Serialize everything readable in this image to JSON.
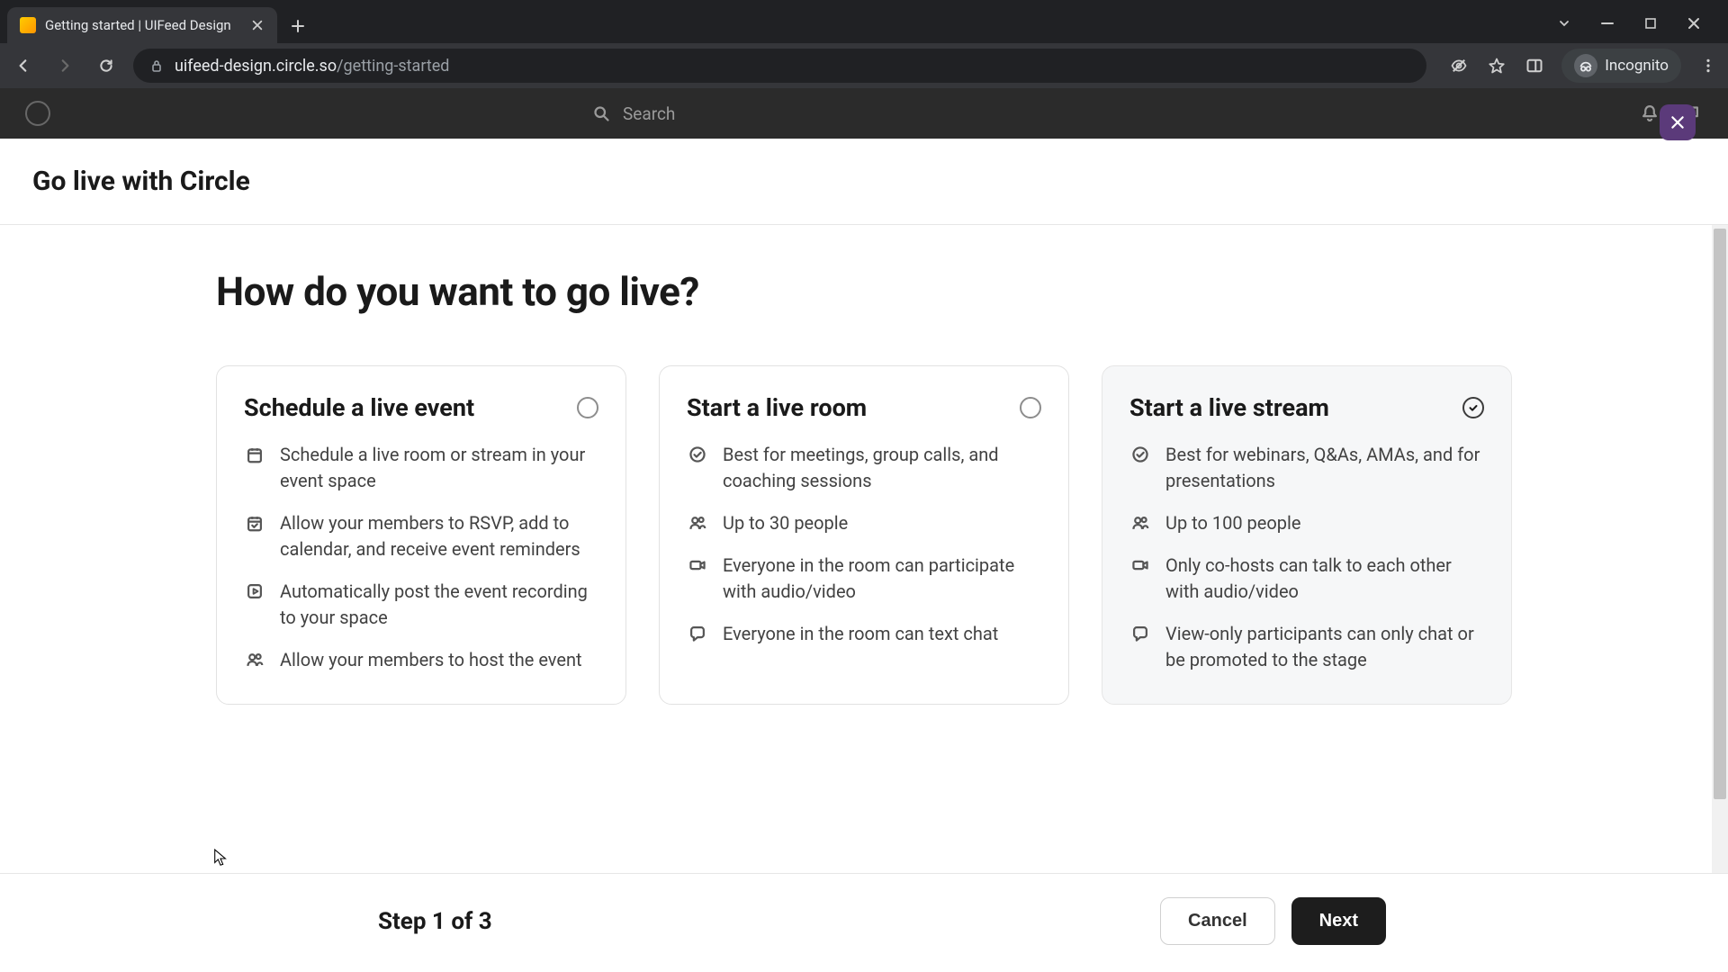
{
  "browser": {
    "tab_title": "Getting started | UIFeed Design",
    "url_domain": "uifeed-design.circle.so",
    "url_path": "/getting-started",
    "incognito_label": "Incognito"
  },
  "app_header": {
    "search_placeholder": "Search"
  },
  "modal": {
    "title": "Go live with Circle",
    "question": "How do you want to go live?",
    "options": [
      {
        "id": "schedule",
        "title": "Schedule a live event",
        "selected": false,
        "features": [
          {
            "icon": "calendar-icon",
            "text": "Schedule a live room or stream in your event space"
          },
          {
            "icon": "calendar-check-icon",
            "text": "Allow your members to RSVP, add to calendar, and receive event reminders"
          },
          {
            "icon": "play-square-icon",
            "text": "Automatically post the event recording to your space"
          },
          {
            "icon": "people-icon",
            "text": "Allow your members to host the event"
          }
        ]
      },
      {
        "id": "room",
        "title": "Start a live room",
        "selected": false,
        "features": [
          {
            "icon": "check-circle-icon",
            "text": "Best for meetings, group calls, and coaching sessions"
          },
          {
            "icon": "people-icon",
            "text": "Up to 30 people"
          },
          {
            "icon": "video-icon",
            "text": "Everyone in the room can participate with audio/video"
          },
          {
            "icon": "chat-icon",
            "text": "Everyone in the room can text chat"
          }
        ]
      },
      {
        "id": "stream",
        "title": "Start a live stream",
        "selected": true,
        "features": [
          {
            "icon": "check-circle-icon",
            "text": "Best for webinars, Q&As, AMAs, and for presentations"
          },
          {
            "icon": "people-icon",
            "text": "Up to 100 people"
          },
          {
            "icon": "video-icon",
            "text": "Only co-hosts can talk to each other with audio/video"
          },
          {
            "icon": "chat-icon",
            "text": "View-only participants can only chat or be promoted to the stage"
          }
        ]
      }
    ],
    "footer": {
      "step_label": "Step 1 of 3",
      "cancel_label": "Cancel",
      "next_label": "Next"
    }
  }
}
